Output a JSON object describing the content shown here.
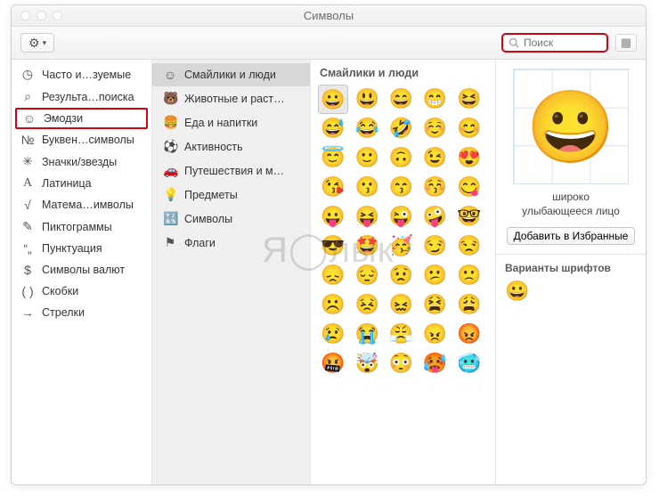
{
  "window": {
    "title": "Символы"
  },
  "toolbar": {
    "search_placeholder": "Поиск"
  },
  "sidebar": {
    "items": [
      {
        "icon": "clock-icon",
        "glyph": "◷",
        "label": "Часто и…зуемые"
      },
      {
        "icon": "search-icon",
        "glyph": "⌕",
        "label": "Результа…поиска"
      },
      {
        "icon": "emoji-icon",
        "glyph": "☺",
        "label": "Эмодзи",
        "selected": true
      },
      {
        "icon": "letters-icon",
        "glyph": "№",
        "label": "Буквен…символы"
      },
      {
        "icon": "star-icon",
        "glyph": "✳",
        "label": "Значки/звезды"
      },
      {
        "icon": "latin-icon",
        "glyph": "A",
        "label": "Латиница"
      },
      {
        "icon": "math-icon",
        "glyph": "√",
        "label": "Матема…имволы"
      },
      {
        "icon": "pictograms-icon",
        "glyph": "✎",
        "label": "Пиктограммы"
      },
      {
        "icon": "punctuation-icon",
        "glyph": "“„",
        "label": "Пунктуация"
      },
      {
        "icon": "currency-icon",
        "glyph": "$",
        "label": "Символы валют"
      },
      {
        "icon": "brackets-icon",
        "glyph": "( )",
        "label": "Скобки"
      },
      {
        "icon": "arrows-icon",
        "glyph": "→",
        "label": "Стрелки"
      }
    ]
  },
  "categories": {
    "items": [
      {
        "icon": "smileys-icon",
        "glyph": "☺",
        "label": "Смайлики и люди",
        "selected": true
      },
      {
        "icon": "animals-icon",
        "glyph": "🐻",
        "label": "Животные и раст…"
      },
      {
        "icon": "food-icon",
        "glyph": "🍔",
        "label": "Еда и напитки"
      },
      {
        "icon": "activity-icon",
        "glyph": "⚽",
        "label": "Активность"
      },
      {
        "icon": "travel-icon",
        "glyph": "🚗",
        "label": "Путешествия и м…"
      },
      {
        "icon": "objects-icon",
        "glyph": "💡",
        "label": "Предметы"
      },
      {
        "icon": "symbols-icon",
        "glyph": "🔣",
        "label": "Символы"
      },
      {
        "icon": "flags-icon",
        "glyph": "⚑",
        "label": "Флаги"
      }
    ]
  },
  "grid": {
    "header": "Смайлики и люди",
    "emojis": [
      "😀",
      "😃",
      "😄",
      "😁",
      "😆",
      "😅",
      "😂",
      "🤣",
      "☺️",
      "😊",
      "😇",
      "🙂",
      "🙃",
      "😉",
      "😍",
      "😘",
      "😗",
      "😙",
      "😚",
      "😋",
      "😛",
      "😝",
      "😜",
      "🤪",
      "🤓",
      "😎",
      "🤩",
      "🥳",
      "😏",
      "😒",
      "😞",
      "😔",
      "😟",
      "😕",
      "🙁",
      "☹️",
      "😣",
      "😖",
      "😫",
      "😩",
      "😢",
      "😭",
      "😤",
      "😠",
      "😡",
      "🤬",
      "🤯",
      "😳",
      "🥵",
      "🥶"
    ],
    "selected_index": 0
  },
  "preview": {
    "emoji": "😀",
    "name_line1": "широко",
    "name_line2": "улыбающееся лицо",
    "add_favorite_label": "Добавить в Избранные"
  },
  "variants": {
    "title": "Варианты шрифтов",
    "items": [
      "😀"
    ]
  },
  "watermark": "Я◯лык"
}
